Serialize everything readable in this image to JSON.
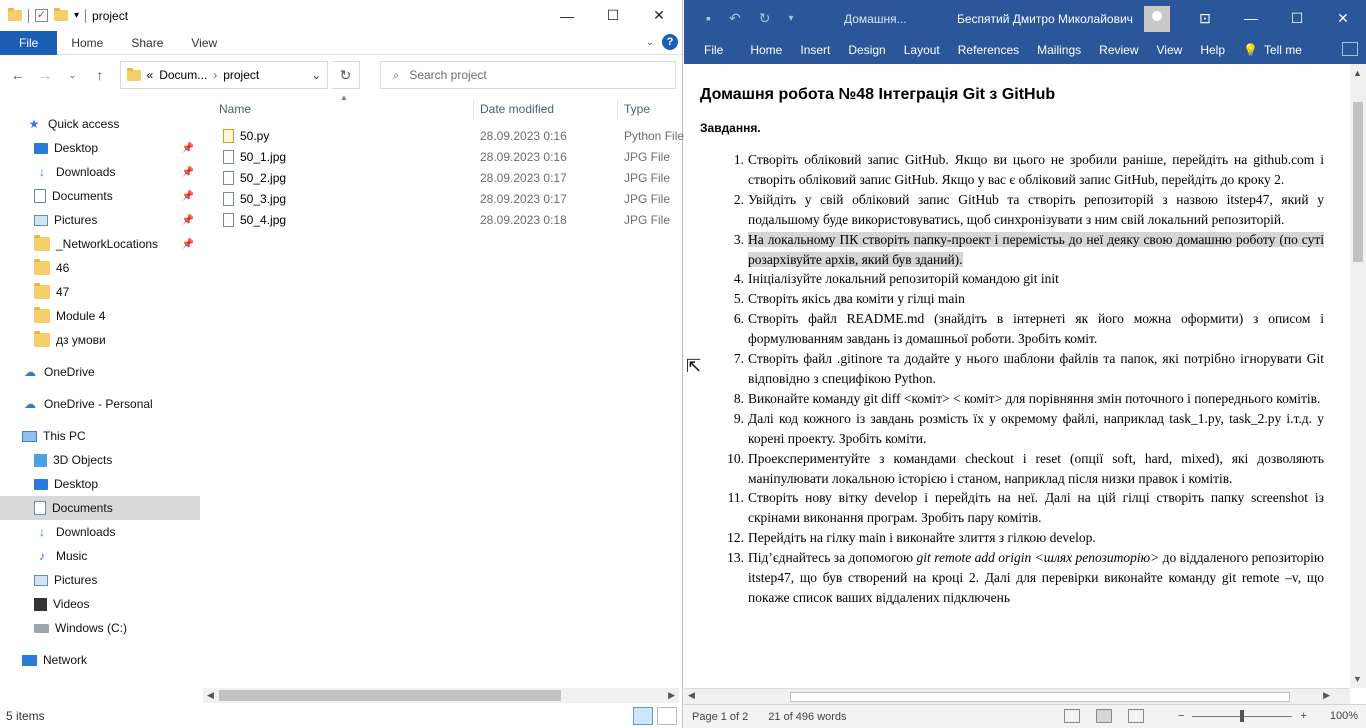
{
  "explorer": {
    "title": "project",
    "ribbon_tabs": [
      "File",
      "Home",
      "Share",
      "View"
    ],
    "address": {
      "prefix": "«",
      "part1": "Docum...",
      "part2": "project"
    },
    "search_placeholder": "Search project",
    "nav": [
      {
        "label": "Quick access",
        "icon": "star-icon",
        "pinned": false
      },
      {
        "label": "Desktop",
        "icon": "desktop-icon",
        "pinned": true
      },
      {
        "label": "Downloads",
        "icon": "download-icon",
        "pinned": true
      },
      {
        "label": "Documents",
        "icon": "documents-icon",
        "pinned": true
      },
      {
        "label": "Pictures",
        "icon": "pictures-icon",
        "pinned": true
      },
      {
        "label": "_NetworkLocations",
        "icon": "folder-icon",
        "pinned": true
      },
      {
        "label": "46",
        "icon": "folder-icon",
        "pinned": false
      },
      {
        "label": "47",
        "icon": "folder-icon",
        "pinned": false
      },
      {
        "label": "Module 4",
        "icon": "folder-icon",
        "pinned": false
      },
      {
        "label": "дз умови",
        "icon": "folder-icon",
        "pinned": false
      },
      {
        "label": "OneDrive",
        "icon": "cloud-icon",
        "pinned": false
      },
      {
        "label": "OneDrive - Personal",
        "icon": "cloud-icon",
        "pinned": false
      },
      {
        "label": "This PC",
        "icon": "computer-icon",
        "pinned": false
      },
      {
        "label": "3D Objects",
        "icon": "cube-icon",
        "pinned": false
      },
      {
        "label": "Desktop",
        "icon": "desktop-icon",
        "pinned": false
      },
      {
        "label": "Documents",
        "icon": "documents-icon",
        "pinned": false,
        "selected": true
      },
      {
        "label": "Downloads",
        "icon": "download-icon",
        "pinned": false
      },
      {
        "label": "Music",
        "icon": "music-icon",
        "pinned": false
      },
      {
        "label": "Pictures",
        "icon": "pictures-icon",
        "pinned": false
      },
      {
        "label": "Videos",
        "icon": "video-icon",
        "pinned": false
      },
      {
        "label": "Windows (C:)",
        "icon": "drive-icon",
        "pinned": false
      },
      {
        "label": "Network",
        "icon": "network-icon",
        "pinned": false
      }
    ],
    "columns": {
      "name": "Name",
      "date": "Date modified",
      "type": "Type"
    },
    "files": [
      {
        "name": "50.py",
        "date": "28.09.2023 0:16",
        "type": "Python File"
      },
      {
        "name": "50_1.jpg",
        "date": "28.09.2023 0:16",
        "type": "JPG File"
      },
      {
        "name": "50_2.jpg",
        "date": "28.09.2023 0:17",
        "type": "JPG File"
      },
      {
        "name": "50_3.jpg",
        "date": "28.09.2023 0:17",
        "type": "JPG File"
      },
      {
        "name": "50_4.jpg",
        "date": "28.09.2023 0:18",
        "type": "JPG File"
      }
    ],
    "status": "5 items"
  },
  "word": {
    "doc_name": "Домашня...",
    "user": "Беспятий Дмитро Миколайович",
    "tabs": [
      "File",
      "Home",
      "Insert",
      "Design",
      "Layout",
      "References",
      "Mailings",
      "Review",
      "View",
      "Help"
    ],
    "tell_me": "Tell me",
    "heading": "Домашня робота №48 Інтеграція Git з GitHub",
    "subheading": "Завдання.",
    "items": [
      {
        "num": "1.",
        "text": "Створіть обліковий запис GitHub. Якщо ви цього не зробили раніше, перейдіть на github.com і створіть обліковий запис GitHub. Якщо у вас є обліковий запис GitHub, перейдіть до кроку 2."
      },
      {
        "num": "2.",
        "text": "Увійдіть у свій обліковий запис GitHub та створіть репозиторій з назвою itstep47, який у подальшому буде використовуватись, щоб синхронізувати з ним свій локальний репозиторій."
      },
      {
        "num": "3.",
        "text": "На локальному ПК створіть папку-проект і перемістьь до неї деяку свою домашню роботу (по суті розархівуйте архів, який був зданий).",
        "highlight": true
      },
      {
        "num": "4.",
        "text": "Ініціалізуйте локальний репозиторій командою git init"
      },
      {
        "num": "5.",
        "text": "Створіть якісь два коміти у гілці main"
      },
      {
        "num": "6.",
        "text": " Створіть файл README.md (знайдіть в інтернеті як його можна оформити) з описом і формулюванням завдань із домашньої роботи.  Зробіть коміт."
      },
      {
        "num": "7.",
        "text": "Створіть файл .gitinore та додайте у нього шаблони файлів та папок, які потрібно ігнорувати Git відповідно з специфікою Python."
      },
      {
        "num": "8.",
        "text": "Виконайте команду git diff  <коміт> < коміт> для порівняння змін поточного і попереднього комітів."
      },
      {
        "num": "9.",
        "text": "Далі код кожного із завдань розмість їх у окремому файлі, наприклад  task_1.py, task_2.py і.т.д. у корені проекту. Зробіть коміти."
      },
      {
        "num": "10.",
        "text": "Проекспериментуйте з командами checkout і reset (опції soft, hard, mixed), які дозволяють маніпулювати локальною історією і станом, наприклад після низки правок і комітів."
      },
      {
        "num": "11.",
        "text": "Створіть нову вітку develop і перейдіть на неї. Далі на цій гілці створіть папку screenshot із скрінами виконання програм. Зробіть пару комітів."
      },
      {
        "num": "12.",
        "text": "Перейдіть на гілку main і виконайте злиття з гілкою develop."
      },
      {
        "num": "13.",
        "text_pre": "Під’єднайтесь за допомогою ",
        "text_em": "git remote add origin <шлях репозиторію>",
        "text_post": " до віддаленого репозиторію itstep47, що був створений на кроці 2. Далі для перевірки виконайте команду git remote –v, що покаже список ваших віддалених підключень"
      }
    ],
    "status": {
      "page": "Page 1 of 2",
      "words": "21 of 496 words",
      "zoom": "100%"
    }
  },
  "colors": {
    "word_blue": "#2b579a",
    "explorer_file_tab": "#1a5fb4",
    "selection": "#d9d9d9"
  }
}
